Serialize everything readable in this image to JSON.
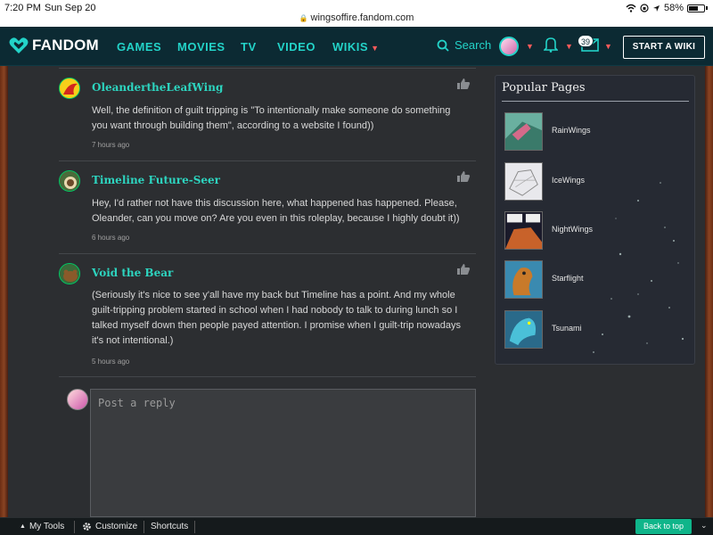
{
  "status_bar": {
    "time": "7:20 PM",
    "date": "Sun Sep 20",
    "url": "wingsoffire.fandom.com",
    "battery": "58%"
  },
  "nav": {
    "logo": "FANDOM",
    "links": [
      "GAMES",
      "MOVIES",
      "TV",
      "VIDEO",
      "WIKIS"
    ],
    "search_label": "Search",
    "notification_count": "39",
    "start_wiki": "START A WIKI",
    "accent_color": "#23d3c8"
  },
  "comments": [
    {
      "author": "OleandertheLeafWing",
      "text": "Well, the definition of guilt tripping is \"To intentionally make someone do something you want through building them\", according to a website I found))",
      "time": "7 hours ago"
    },
    {
      "author": "Timeline Future-Seer",
      "text": "Hey, I'd rather not have this discussion here, what happened has happened. Please, Oleander, can you move on? Are you even in this roleplay, because I highly doubt it))",
      "time": "6 hours ago"
    },
    {
      "author": "Void the Bear",
      "text": "(Seriously it's nice to see y'all have my back but Timeline has a point. And my whole guilt-tripping problem started in school when I had nobody to talk to during lunch so I talked myself down then people payed attention. I promise when I guilt-trip nowadays it's not intentional.)",
      "time": "5 hours ago"
    }
  ],
  "reply": {
    "placeholder": "Post a reply"
  },
  "popular_pages": {
    "title": "Popular Pages",
    "items": [
      "RainWings",
      "IceWings",
      "NightWings",
      "Starflight",
      "Tsunami"
    ]
  },
  "toolbar": {
    "my_tools": "My Tools",
    "customize": "Customize",
    "shortcuts": "Shortcuts",
    "back_to_top": "Back to top"
  }
}
